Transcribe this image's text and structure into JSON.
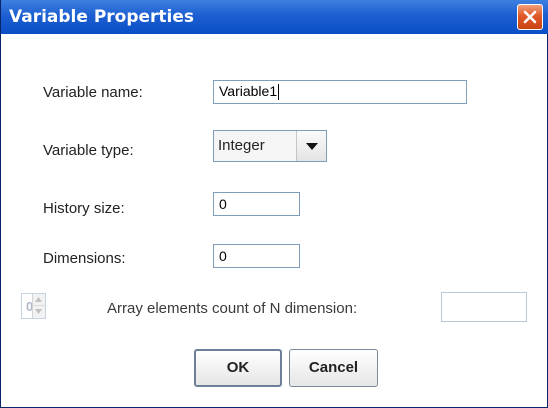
{
  "window": {
    "title": "Variable Properties"
  },
  "form": {
    "name_label": "Variable name:",
    "name_value": "Variable1",
    "type_label": "Variable type:",
    "type_value": "Integer",
    "history_label": "History size:",
    "history_value": "0",
    "dimensions_label": "Dimensions:",
    "dimensions_value": "0",
    "array_spinner_value": "0",
    "array_label": "Array elements count of N dimension:",
    "array_value": ""
  },
  "buttons": {
    "ok": "OK",
    "cancel": "Cancel"
  },
  "icons": {
    "close": "close-icon",
    "dropdown": "chevron-down-icon",
    "spin_up": "spin-up-icon",
    "spin_down": "spin-down-icon"
  }
}
